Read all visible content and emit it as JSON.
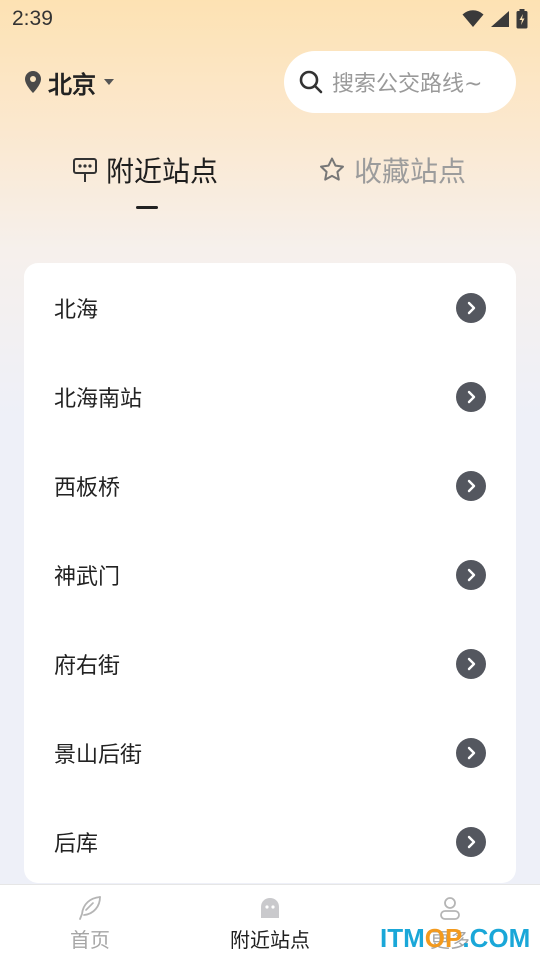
{
  "status": {
    "time": "2:39"
  },
  "header": {
    "city": "北京",
    "search_placeholder": "搜索公交路线~"
  },
  "tabs": [
    {
      "label": "附近站点",
      "active": true
    },
    {
      "label": "收藏站点",
      "active": false
    }
  ],
  "stations": [
    "北海",
    "北海南站",
    "西板桥",
    "神武门",
    "府右街",
    "景山后街",
    "后库"
  ],
  "nav": [
    {
      "label": "首页"
    },
    {
      "label": "附近站点",
      "active": true
    },
    {
      "label": "更多"
    }
  ],
  "watermark": {
    "part1": "ITM",
    "part2": "OP",
    "part3": ".COM"
  },
  "colors": {
    "accent_chevron": "#54575f",
    "active_text": "#1e1e1e",
    "inactive_text": "#9c9c9c",
    "watermark_blue": "#1aa7d8",
    "watermark_orange": "#f39a1e"
  }
}
